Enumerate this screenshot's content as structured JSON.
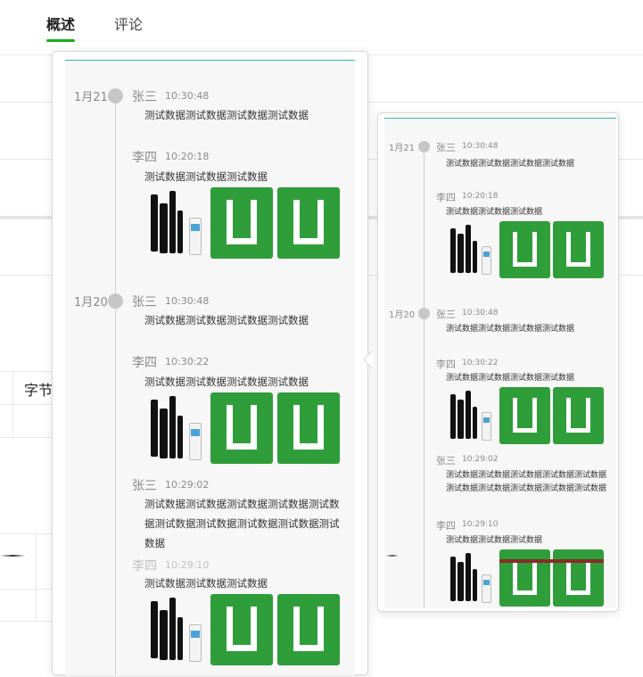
{
  "tabs": [
    {
      "label": "概述",
      "active": true
    },
    {
      "label": "评论",
      "active": false
    }
  ],
  "background": {
    "table_header_partial": "字节"
  },
  "timeline": [
    {
      "date": "1月21",
      "entries": [
        {
          "name": "张三",
          "time": "10:30:48",
          "text": "测试数据测试数据测试数据测试数据"
        },
        {
          "name": "李四",
          "time": "10:20:18",
          "text": "测试数据测试数据测试数据"
        }
      ]
    },
    {
      "date": "1月20",
      "entries": [
        {
          "name": "张三",
          "time": "10:30:48",
          "text": "测试数据测试数据测试数据测试数据"
        },
        {
          "name": "李四",
          "time": "10:30:22",
          "text": "测试数据测试数据测试数据测试数据"
        },
        {
          "name": "张三",
          "time": "10:29:02",
          "text": "测试数据测试数据测试数据测试数据测试数据测试数据测试数据测试数据测试数据测试数据"
        },
        {
          "name": "李四",
          "time": "10:29:10",
          "text": "测试数据测试数据测试数据"
        }
      ]
    }
  ],
  "colors": {
    "accent": "#1aad19",
    "logo_green": "#2f9e3a",
    "timeline_dot": "#c6c6c6"
  },
  "icons": {
    "logo": "u-logo-icon",
    "product": "product-image"
  }
}
